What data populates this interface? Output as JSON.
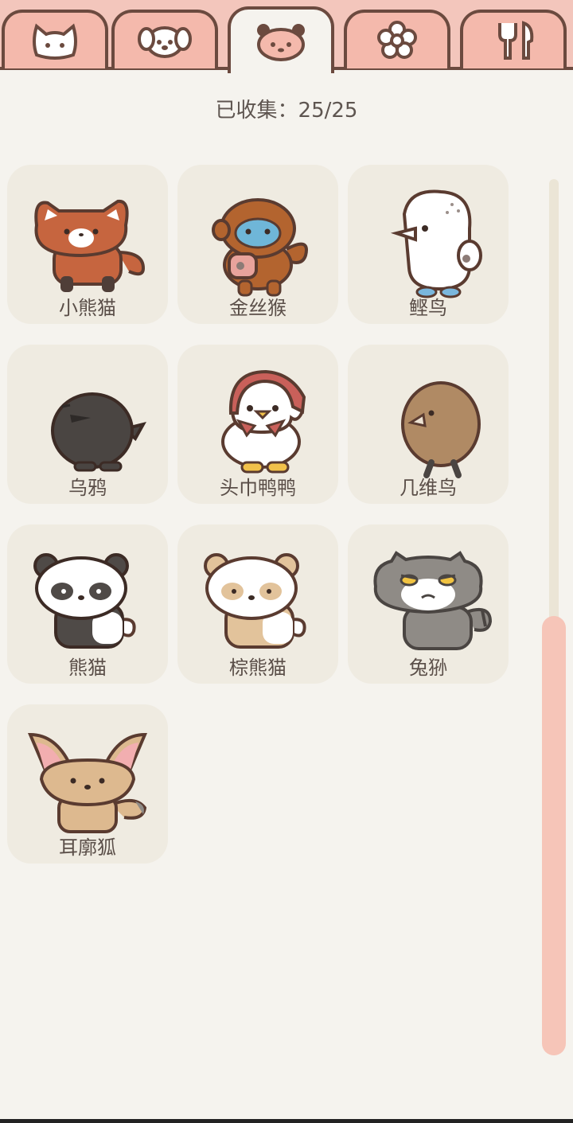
{
  "tabs": [
    {
      "name": "cat-icon",
      "active": false
    },
    {
      "name": "dog-icon",
      "active": false
    },
    {
      "name": "panda-icon",
      "active": true
    },
    {
      "name": "flower-icon",
      "active": false
    },
    {
      "name": "utensils-icon",
      "active": false
    }
  ],
  "collection": {
    "label": "已收集：25/25"
  },
  "animals": [
    {
      "label": "小熊猫",
      "icon": "red-panda-icon"
    },
    {
      "label": "金丝猴",
      "icon": "golden-monkey-icon"
    },
    {
      "label": "鲣鸟",
      "icon": "booby-bird-icon"
    },
    {
      "label": "乌鸦",
      "icon": "crow-icon"
    },
    {
      "label": "头巾鸭鸭",
      "icon": "headscarf-duck-icon"
    },
    {
      "label": "几维鸟",
      "icon": "kiwi-bird-icon"
    },
    {
      "label": "熊猫",
      "icon": "panda-icon"
    },
    {
      "label": "棕熊猫",
      "icon": "brown-panda-icon"
    },
    {
      "label": "兔狲",
      "icon": "pallas-cat-icon"
    },
    {
      "label": "耳廓狐",
      "icon": "fennec-fox-icon"
    }
  ],
  "colors": {
    "background": "#f5f3ee",
    "card": "#efebe1",
    "tab_pink": "#f4b9ac",
    "outline": "#6b4a3f",
    "scroll_thumb": "#f6c5b8"
  }
}
